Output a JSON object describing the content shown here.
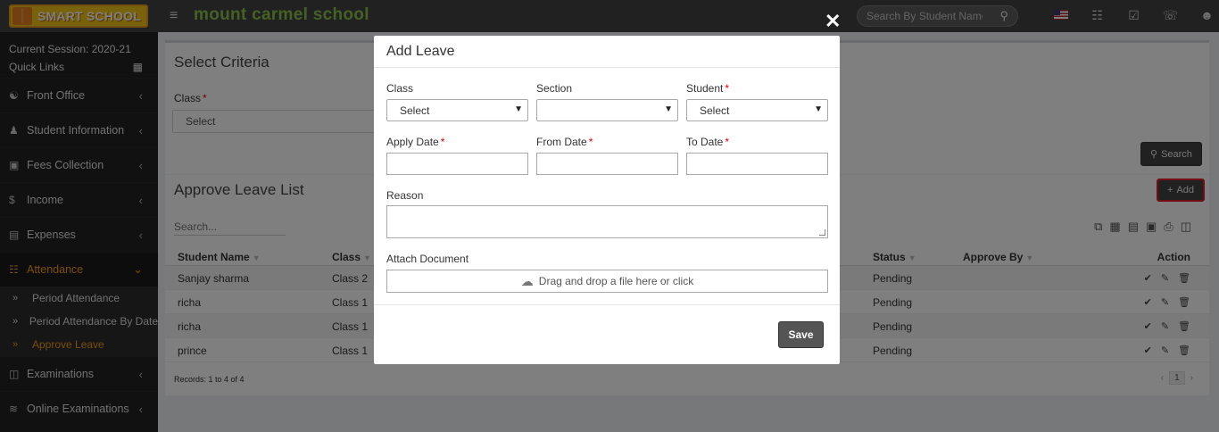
{
  "header": {
    "logo_text": "SMART SCHOOL",
    "school_name": "mount carmel school",
    "search_placeholder": "Search By Student Name"
  },
  "sidebar": {
    "session": "Current Session: 2020-21",
    "quick_links": "Quick Links",
    "items": [
      {
        "label": "Front Office"
      },
      {
        "label": "Student Information"
      },
      {
        "label": "Fees Collection"
      },
      {
        "label": "Income"
      },
      {
        "label": "Expenses"
      },
      {
        "label": "Attendance"
      },
      {
        "label": "Examinations"
      },
      {
        "label": "Online Examinations"
      }
    ],
    "attendance_sub": [
      {
        "label": "Period Attendance"
      },
      {
        "label": "Period Attendance By Date"
      },
      {
        "label": "Approve Leave"
      }
    ]
  },
  "criteria": {
    "title": "Select Criteria",
    "class_label": "Class",
    "class_value": "Select",
    "search_button": "Search"
  },
  "list": {
    "title": "Approve Leave List",
    "add_button": "Add",
    "search_placeholder": "Search...",
    "columns": [
      "Student Name",
      "Class",
      "Status",
      "Approve By",
      "Action"
    ],
    "rows": [
      {
        "name": "Sanjay sharma",
        "class": "Class 2",
        "status": "Pending"
      },
      {
        "name": "richa",
        "class": "Class 1",
        "status": "Pending"
      },
      {
        "name": "richa",
        "class": "Class 1",
        "status": "Pending"
      },
      {
        "name": "prince",
        "class": "Class 1",
        "status": "Pending"
      }
    ],
    "records": "Records: 1 to 4 of 4",
    "page": "1"
  },
  "modal": {
    "title": "Add Leave",
    "class_label": "Class",
    "class_value": "Select",
    "section_label": "Section",
    "section_value": "",
    "student_label": "Student",
    "student_value": "Select",
    "apply_date_label": "Apply Date",
    "from_date_label": "From Date",
    "to_date_label": "To Date",
    "reason_label": "Reason",
    "attach_label": "Attach Document",
    "dropzone_text": "Drag and drop a file here or click",
    "save_button": "Save"
  },
  "colors": {
    "accent": "#f39c12",
    "school_name": "#8bc34a",
    "topbar": "#424242",
    "sidebar": "#222222",
    "highlight_border": "#e51c23"
  }
}
